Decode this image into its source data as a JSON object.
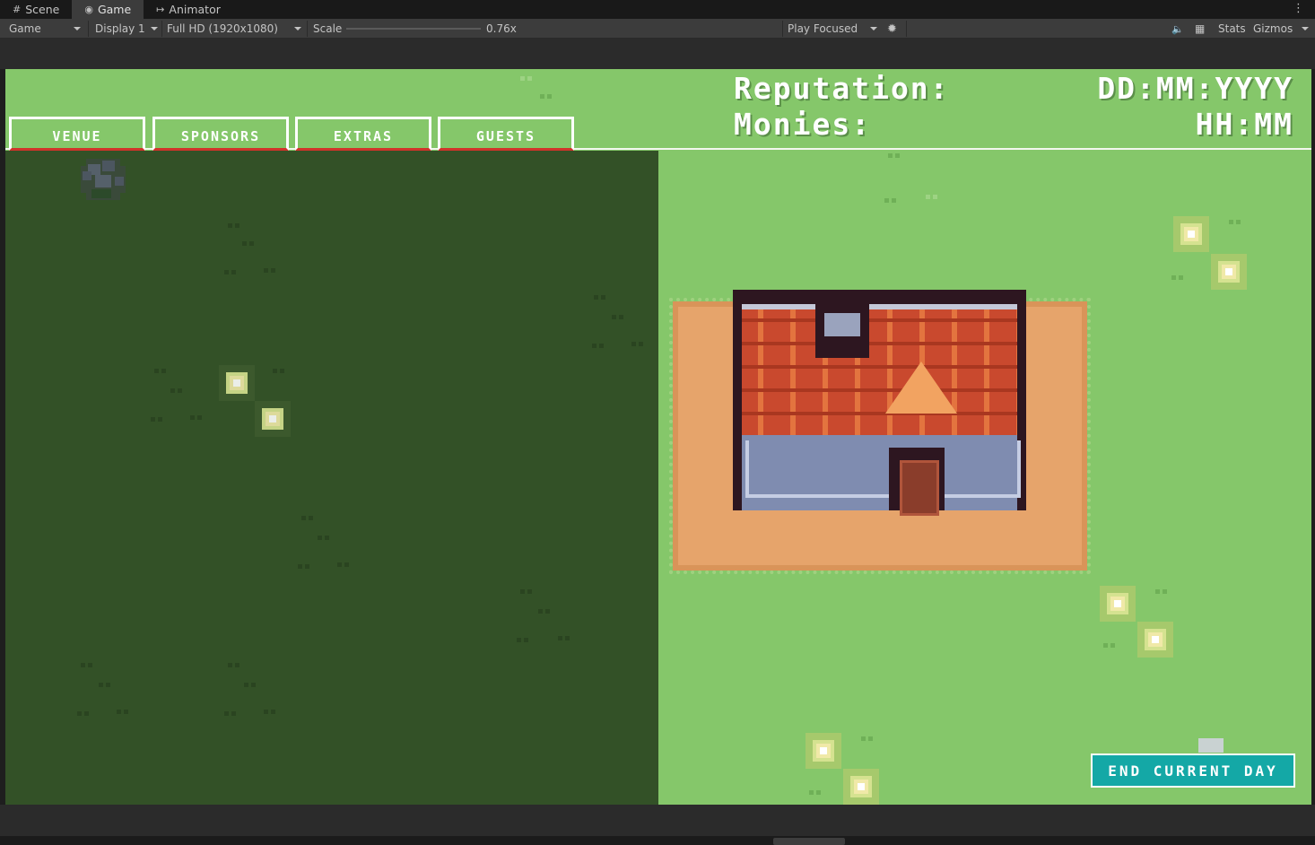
{
  "editor": {
    "tabs": [
      {
        "label": "Scene",
        "icon": "grid-icon"
      },
      {
        "label": "Game",
        "icon": "gamepad-icon"
      },
      {
        "label": "Animator",
        "icon": "animator-icon"
      }
    ],
    "toolbar": {
      "view_mode": "Game",
      "display": "Display 1",
      "resolution": "Full HD (1920x1080)",
      "scale_label": "Scale",
      "scale_value": "0.76x",
      "scale_fraction": 0.0,
      "play_mode": "Play Focused",
      "stats_label": "Stats",
      "gizmos_label": "Gizmos"
    }
  },
  "game": {
    "menu_tabs": [
      "VENUE",
      "SPONSORS",
      "EXTRAS",
      "GUESTS"
    ],
    "hud": {
      "reputation_label": "Reputation:",
      "monies_label": "Monies:",
      "date_placeholder": "DD:MM:YYYY",
      "time_placeholder": "HH:MM"
    },
    "end_day_label": "END CURRENT DAY",
    "colors": {
      "grass": "#85c76a",
      "panel": "#335127",
      "button_teal": "#14a8a6",
      "tab_underline": "#d0332a"
    }
  }
}
